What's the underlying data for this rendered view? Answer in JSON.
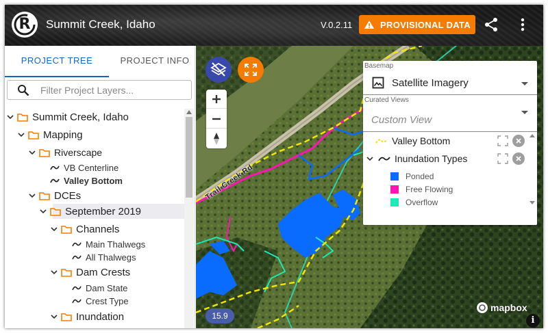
{
  "header": {
    "logo_text": "R",
    "title": "Summit Creek, Idaho",
    "version": "V.0.2.11",
    "provisional_label": "PROVISIONAL DATA",
    "bg_color": "#1a1a1a",
    "accent_color": "#f57c00"
  },
  "sidebar": {
    "tabs": [
      {
        "label": "PROJECT TREE",
        "active": true
      },
      {
        "label": "PROJECT INFO",
        "active": false
      }
    ],
    "filter_placeholder": "Filter Project Layers...",
    "tree": {
      "root": "Summit Creek, Idaho",
      "mapping": "Mapping",
      "riverscape": "Riverscape",
      "vb_centerline": "VB Centerline",
      "valley_bottom": "Valley Bottom",
      "dces": "DCEs",
      "september": "September 2019",
      "channels": "Channels",
      "main_thalwegs": "Main Thalwegs",
      "all_thalwegs": "All Thalwegs",
      "dam_crests": "Dam Crests",
      "dam_state": "Dam State",
      "crest_type": "Crest Type",
      "inundation": "Inundation"
    },
    "folder_color": "#f57c00",
    "active_color": "#1565c0"
  },
  "map": {
    "zoom_level": "15.9",
    "road_label": "Trail Creek Rd",
    "attribution": "mapbox",
    "info_label": "i"
  },
  "panel": {
    "basemap_label": "Basemap",
    "basemap_value": "Satellite Imagery",
    "curated_label": "Curated Views",
    "curated_value": "Custom View",
    "layers": [
      {
        "label": "Valley Bottom",
        "line_color": "#f2e600"
      },
      {
        "label": "Inundation Types",
        "line_color": "#222222"
      }
    ],
    "legend": [
      {
        "label": "Ponded",
        "color": "#0a6cff"
      },
      {
        "label": "Free Flowing",
        "color": "#ff14b4"
      },
      {
        "label": "Overflow",
        "color": "#1de9b6"
      }
    ]
  }
}
